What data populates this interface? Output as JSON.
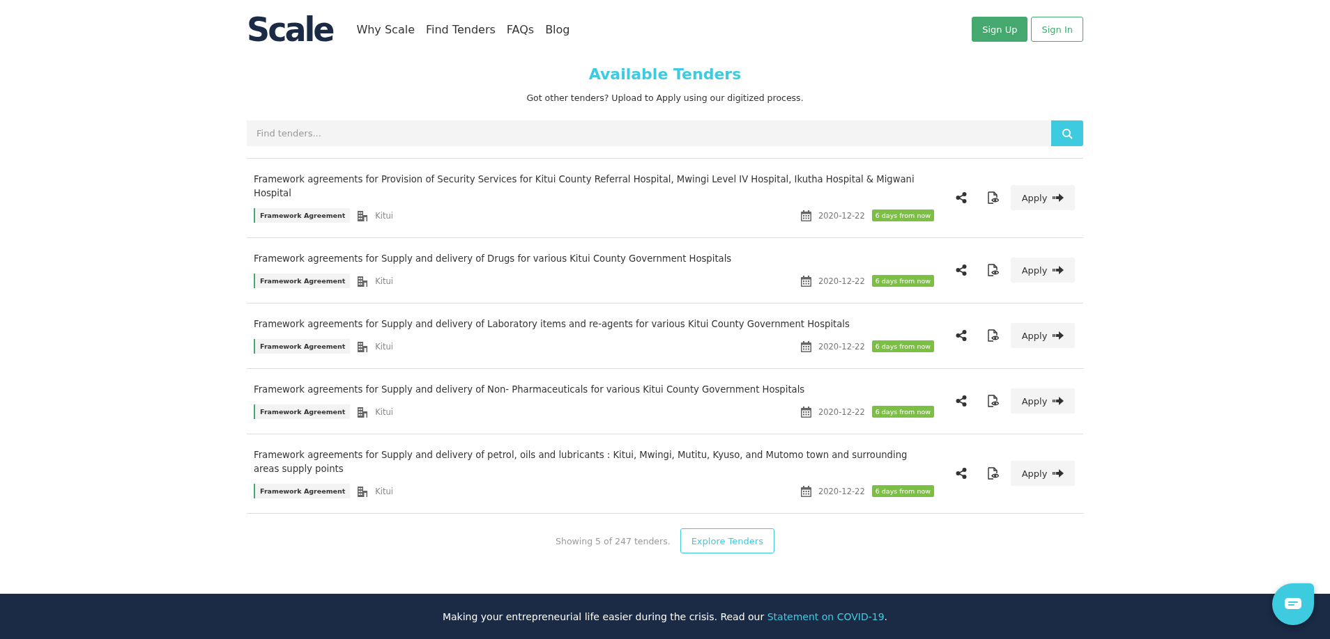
{
  "header": {
    "logo": "Scale",
    "nav": [
      "Why Scale",
      "Find Tenders",
      "FAQs",
      "Blog"
    ],
    "buttons": [
      {
        "label": "Sign Up",
        "kind": "primary"
      },
      {
        "label": "Sign In",
        "kind": "outline"
      }
    ]
  },
  "heading": {
    "title": "Available Tenders",
    "subtitle": "Got other tenders? Upload to Apply using our digitized process."
  },
  "search": {
    "placeholder": "Find tenders..."
  },
  "tenders": [
    {
      "title": "Framework agreements for Provision of Security Services for Kitui County Referral Hospital, Mwingi Level IV Hospital, Ikutha Hospital & Migwani Hospital",
      "category": "Framework Agreement",
      "location": "Kitui",
      "date": "2020-12-22",
      "deadline": "6 days from now",
      "action": "Apply"
    },
    {
      "title": "Framework agreements for Supply and delivery of Drugs for various Kitui County Government Hospitals",
      "category": "Framework Agreement",
      "location": "Kitui",
      "date": "2020-12-22",
      "deadline": "6 days from now",
      "action": "Apply"
    },
    {
      "title": "Framework agreements for Supply and delivery of Laboratory items and re-agents for various Kitui County Government Hospitals",
      "category": "Framework Agreement",
      "location": "Kitui",
      "date": "2020-12-22",
      "deadline": "6 days from now",
      "action": "Apply"
    },
    {
      "title": "Framework agreements for Supply and delivery of Non- Pharmaceuticals for various Kitui County Government Hospitals",
      "category": "Framework Agreement",
      "location": "Kitui",
      "date": "2020-12-22",
      "deadline": "6 days from now",
      "action": "Apply"
    },
    {
      "title": "Framework agreements for Supply and delivery of petrol, oils and lubricants : Kitui, Mwingi, Mutitu, Kyuso, and Mutomo town and surrounding areas supply points",
      "category": "Framework Agreement",
      "location": "Kitui",
      "date": "2020-12-22",
      "deadline": "6 days from now",
      "action": "Apply"
    }
  ],
  "summary": {
    "text": "Showing 5 of 247 tenders.",
    "button": "Explore Tenders"
  },
  "footer": {
    "text": "Making your entrepreneurial life easier during the crisis. Read our",
    "link": "Statement on COVID-19",
    "end": "."
  }
}
